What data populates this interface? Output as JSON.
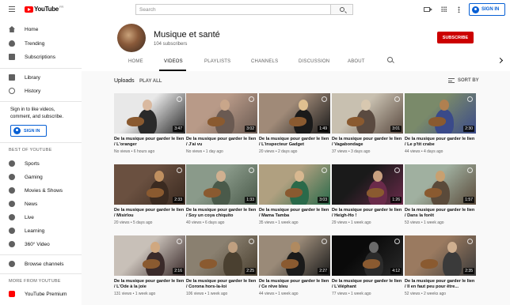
{
  "topbar": {
    "logo_text": "YouTube",
    "logo_region": "FR",
    "search_placeholder": "Search",
    "sign_in": "SIGN IN"
  },
  "sidebar": {
    "primary": [
      {
        "label": "Home",
        "icon": "home-icon"
      },
      {
        "label": "Trending",
        "icon": "trending-icon"
      },
      {
        "label": "Subscriptions",
        "icon": "subscriptions-icon"
      }
    ],
    "secondary": [
      {
        "label": "Library",
        "icon": "library-icon"
      },
      {
        "label": "History",
        "icon": "history-icon"
      }
    ],
    "signin_prompt": "Sign in to like videos, comment, and subscribe.",
    "signin_button": "SIGN IN",
    "best_heading": "BEST OF YOUTUBE",
    "best": [
      {
        "label": "Sports",
        "icon": "sports-icon"
      },
      {
        "label": "Gaming",
        "icon": "gaming-icon"
      },
      {
        "label": "Movies & Shows",
        "icon": "movies-icon"
      },
      {
        "label": "News",
        "icon": "news-icon"
      },
      {
        "label": "Live",
        "icon": "live-icon"
      },
      {
        "label": "Learning",
        "icon": "learning-icon"
      },
      {
        "label": "360° Video",
        "icon": "360-icon"
      }
    ],
    "browse_channels": "Browse channels",
    "more_heading": "MORE FROM YOUTUBE",
    "premium": "YouTube Premium"
  },
  "channel": {
    "name": "Musique et santé",
    "subscribers": "104 subscribers",
    "subscribe": "SUBSCRIBE",
    "tabs": [
      "HOME",
      "VIDEOS",
      "PLAYLISTS",
      "CHANNELS",
      "DISCUSSION",
      "ABOUT"
    ],
    "active_tab": "VIDEOS"
  },
  "section": {
    "title": "Uploads",
    "play_all": "PLAY ALL",
    "sort_by": "SORT BY"
  },
  "videos": [
    {
      "title": "De la musique pour garder le lien / L'oranger",
      "meta": "No views • 6 hours ago",
      "duration": "3:47",
      "colors": [
        "#e8e8e8",
        "#2a2a2a",
        "#d9b9a0"
      ]
    },
    {
      "title": "De la musique pour garder le lien / J'ai vu",
      "meta": "No views • 1 day ago",
      "duration": "3:02",
      "colors": [
        "#b89a88",
        "#6a5a52",
        "#c9a68a"
      ]
    },
    {
      "title": "De la musique pour garder le lien / L'inspecteur Gadget",
      "meta": "20 views • 2 days ago",
      "duration": "1:49",
      "colors": [
        "#a08a78",
        "#1a1a1a",
        "#e0c090"
      ]
    },
    {
      "title": "De la musique pour garder le lien / Vagabondage",
      "meta": "37 views • 3 days ago",
      "duration": "3:01",
      "colors": [
        "#c8c0b0",
        "#5a4a40",
        "#d8c8b0"
      ]
    },
    {
      "title": "De la musique pour garder le lien / Le p'tit crabe",
      "meta": "44 views • 4 days ago",
      "duration": "2:30",
      "colors": [
        "#7a8a6a",
        "#3a4a8a",
        "#b08050"
      ]
    },
    {
      "title": "De la musique pour garder le lien / Misirlou",
      "meta": "20 views • 5 days ago",
      "duration": "2:33",
      "colors": [
        "#6a5040",
        "#3a2a20",
        "#c09060"
      ]
    },
    {
      "title": "De la musique pour garder le lien / Soy un coya chiquito",
      "meta": "40 views • 6 days ago",
      "duration": "1:33",
      "colors": [
        "#8a9a8a",
        "#4a5a4a",
        "#d0b090"
      ]
    },
    {
      "title": "De la musique pour garder le lien / Mama Tamba",
      "meta": "35 views • 1 week ago",
      "duration": "3:03",
      "colors": [
        "#b0a080",
        "#2a6a4a",
        "#d8b890"
      ]
    },
    {
      "title": "De la musique pour garder le lien / Heigh-Ho !",
      "meta": "29 views • 1 week ago",
      "duration": "1:26",
      "colors": [
        "#1a1a1a",
        "#6a2a4a",
        "#c8a080"
      ]
    },
    {
      "title": "De la musique pour garder le lien / Dans la forêt",
      "meta": "53 views • 1 week ago",
      "duration": "1:57",
      "colors": [
        "#a0b0a0",
        "#5a4a3a",
        "#c8a070"
      ]
    },
    {
      "title": "De la musique pour garder le lien / L'Ode à la joie",
      "meta": "131 views • 1 week ago",
      "duration": "2:16",
      "colors": [
        "#c8c0b8",
        "#3a2a2a",
        "#d0a880"
      ]
    },
    {
      "title": "De la musique pour garder le lien / Corona hors-la-loi",
      "meta": "106 views • 1 week ago",
      "duration": "2:25",
      "colors": [
        "#8a8070",
        "#4a4030",
        "#c0a080"
      ]
    },
    {
      "title": "De la musique pour garder le lien / Ce rêve bleu",
      "meta": "44 views • 1 week ago",
      "duration": "2:27",
      "colors": [
        "#9a8a78",
        "#1a1a1a",
        "#b08a60"
      ]
    },
    {
      "title": "De la musique pour garder le lien / L'éléphant",
      "meta": "77 views • 1 week ago",
      "duration": "4:12",
      "colors": [
        "#0a0a0a",
        "#2a2a2a",
        "#6a6a6a"
      ]
    },
    {
      "title": "De la musique pour garder le lien / Il en faut peu pour être...",
      "meta": "52 views • 2 weeks ago",
      "duration": "2:35",
      "colors": [
        "#9a7a60",
        "#3a3a3a",
        "#d0b090"
      ]
    }
  ]
}
